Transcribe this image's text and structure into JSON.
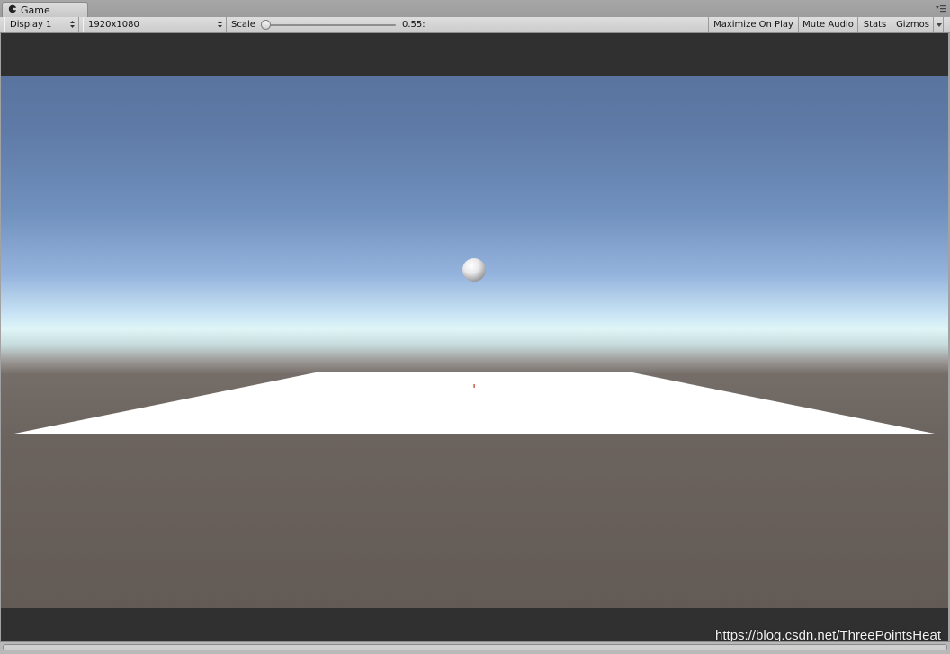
{
  "tab": {
    "title": "Game",
    "icon": "game-controller-icon"
  },
  "toolbar": {
    "display": {
      "value": "Display 1"
    },
    "resolution": {
      "value": "1920x1080"
    },
    "scale": {
      "label": "Scale",
      "value_text": "0.55:",
      "value": 0.55
    },
    "buttons": {
      "maximize_on_play": "Maximize On Play",
      "mute_audio": "Mute Audio",
      "stats": "Stats",
      "gizmos": "Gizmos"
    }
  },
  "watermark": "https://blog.csdn.net/ThreePointsHeat",
  "colors": {
    "sky_top": "#5a74a0",
    "horizon": "#dff5f6",
    "ground": "#6b625c",
    "plane": "#ffffff",
    "letterbox": "#303030"
  }
}
